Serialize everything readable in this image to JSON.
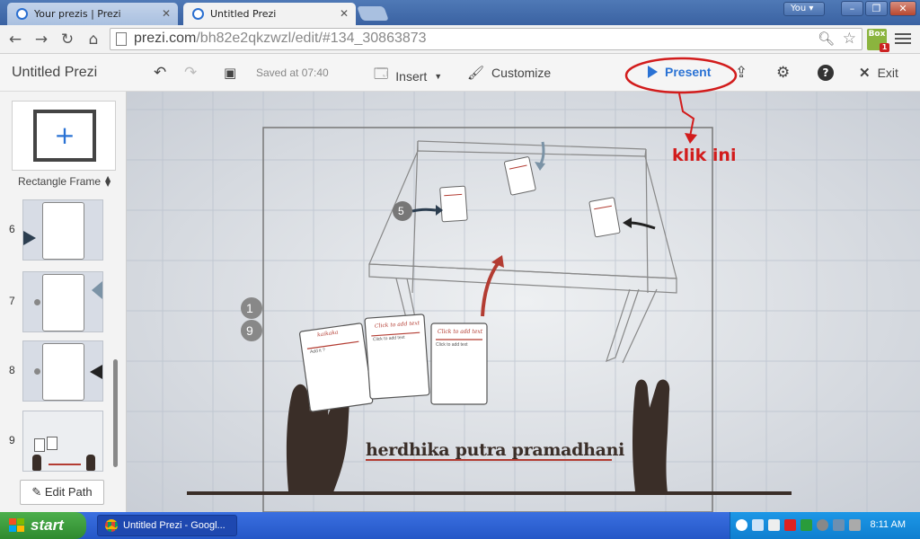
{
  "browser": {
    "tabs": [
      {
        "label": "Your prezis | Prezi",
        "close": "✕"
      },
      {
        "label": "Untitled Prezi",
        "close": "✕"
      }
    ],
    "user_button": "You ▾",
    "url_host": "prezi.com",
    "url_path": "/bh82e2qkzwzl/edit/#134_30863873",
    "extension_label": "Box",
    "extension_badge": "1"
  },
  "editor": {
    "title": "Untitled Prezi",
    "saved_status": "Saved at 07:40",
    "insert_label": "Insert",
    "customize_label": "Customize",
    "present_label": "Present",
    "exit_label": "Exit",
    "frame_type": "Rectangle Frame",
    "edit_path_label": "Edit Path",
    "thumbnails": [
      {
        "num": "6"
      },
      {
        "num": "7"
      },
      {
        "num": "8"
      },
      {
        "num": "9"
      }
    ]
  },
  "canvas": {
    "step_badges": [
      "5",
      "1",
      "9"
    ],
    "card_titles": [
      "kaikaka",
      "Click to add text",
      "Click to add text"
    ],
    "card_subtitles": [
      "Add it ?",
      "Click to add text",
      "Click to add text"
    ],
    "name_text": "herdhika putra pramadhani",
    "callout_text": "klik ini"
  },
  "taskbar": {
    "start_label": "start",
    "task_label": "Untitled Prezi - Googl...",
    "clock": "8:11 AM"
  },
  "colors": {
    "accent": "#2a72d4",
    "annotation_red": "#d21c1c",
    "card_red": "#b33c32",
    "taskbar": "#2557c7",
    "start_green": "#3a9c3a"
  }
}
